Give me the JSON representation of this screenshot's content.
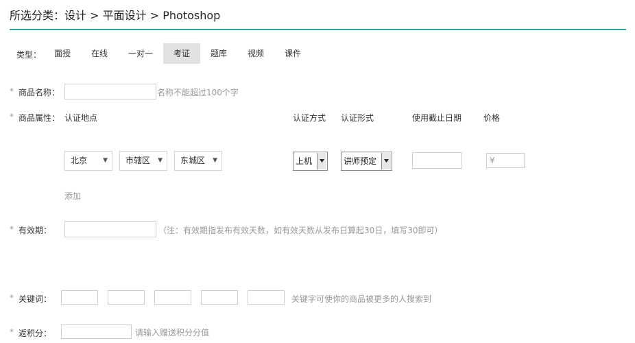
{
  "breadcrumb": {
    "prefix": "所选分类：",
    "items": [
      "设计",
      "平面设计",
      "Photoshop"
    ],
    "separator": ">"
  },
  "type_filter": {
    "label": "类型：",
    "tabs": [
      "面授",
      "在线",
      "一对一",
      "考证",
      "题库",
      "视频",
      "课件"
    ],
    "active": "考证"
  },
  "form": {
    "required_mark": "*",
    "name": {
      "label": "商品名称：",
      "value": "",
      "hint": "名称不能超过100个字"
    },
    "attributes": {
      "label": "商品属性：",
      "columns": {
        "location": "认证地点",
        "method": "认证方式",
        "form": "认证形式",
        "deadline": "使用截止日期",
        "price": "价格"
      },
      "province": "北京",
      "city": "市辖区",
      "district": "东城区",
      "method_value": "上机",
      "form_value": "讲师预定",
      "deadline_value": "",
      "price_symbol": "¥",
      "price_value": "",
      "add_link": "添加"
    },
    "validity": {
      "label": "有效期：",
      "value": "",
      "hint": "（注：有效期指发布有效天数，如有效天数从发布日算起30日，填写30即可）"
    },
    "keywords": {
      "label": "关键词：",
      "values": [
        "",
        "",
        "",
        "",
        ""
      ],
      "hint": "关键字可使你的商品被更多的人搜索到"
    },
    "points": {
      "label": "返积分：",
      "value": "",
      "placeholder": "请输入赠送积分分值"
    }
  },
  "colors": {
    "accent": "#2aa597",
    "active_tab_bg": "#e2e2e2",
    "hint": "#999999"
  }
}
